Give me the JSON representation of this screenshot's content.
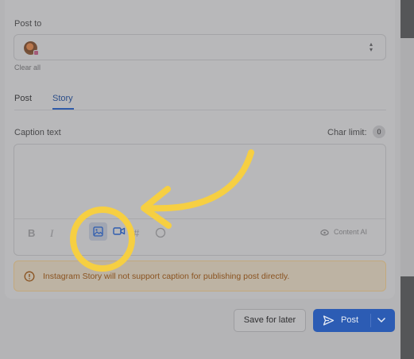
{
  "composer": {
    "post_to_label": "Post to",
    "clear_all": "Clear all",
    "tabs": [
      {
        "label": "Post",
        "active": false
      },
      {
        "label": "Story",
        "active": true
      }
    ],
    "caption_label": "Caption text",
    "char_limit_label": "Char limit:",
    "char_count": "0",
    "toolbar": {
      "bold": "B",
      "italic": "I",
      "hashtag": "#",
      "content_ai": "Content AI",
      "icons": [
        "bold-icon",
        "italic-icon",
        "image-icon",
        "video-icon",
        "hashtag-icon",
        "emoji-icon",
        "content-ai-icon"
      ]
    },
    "warning_text": "Instagram Story will not support caption for publishing post directly."
  },
  "actions": {
    "save_label": "Save for later",
    "post_label": "Post"
  },
  "colors": {
    "accent": "#2c5cb4",
    "highlight": "#f6cf42",
    "warning": "#8a5320"
  }
}
